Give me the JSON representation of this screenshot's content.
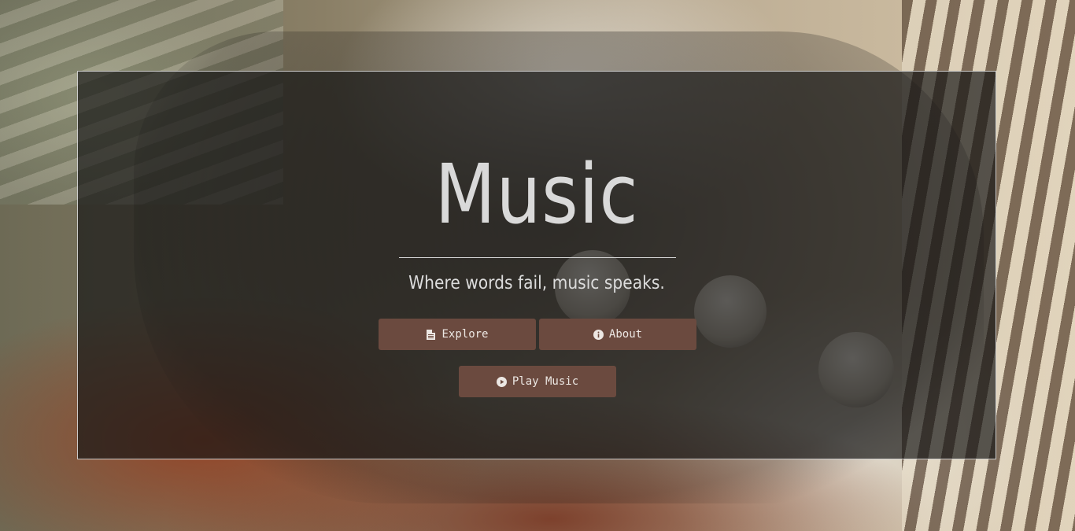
{
  "hero": {
    "title": "Music",
    "subtitle": "Where words fail, music speaks."
  },
  "buttons": {
    "explore": {
      "label": "Explore",
      "icon": "document-icon"
    },
    "about": {
      "label": "About",
      "icon": "info-circle-icon"
    },
    "play": {
      "label": "Play Music",
      "icon": "play-circle-icon"
    }
  },
  "colors": {
    "button_background": "#6b4a3f",
    "overlay": "rgba(20,20,20,0.68)",
    "text": "#d9d9d9"
  }
}
